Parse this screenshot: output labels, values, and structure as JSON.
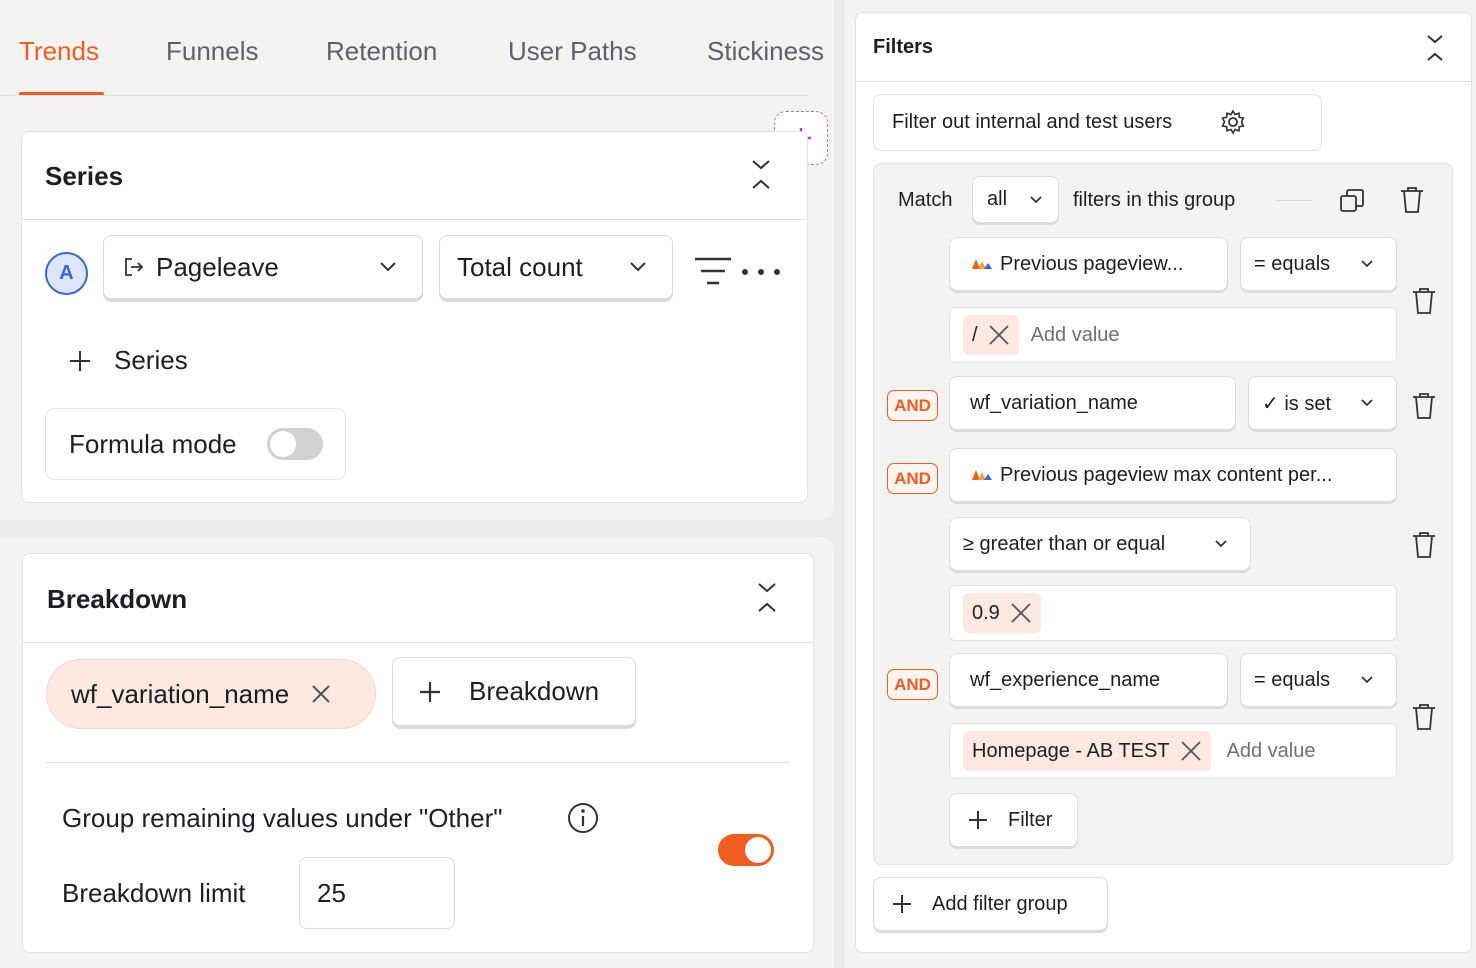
{
  "tabs": [
    {
      "label": "Trends",
      "active": true
    },
    {
      "label": "Funnels",
      "active": false
    },
    {
      "label": "Retention",
      "active": false
    },
    {
      "label": "User Paths",
      "active": false
    },
    {
      "label": "Stickiness",
      "active": false
    }
  ],
  "series": {
    "title": "Series",
    "letter": "A",
    "event_label": "Pageleave",
    "math_label": "Total count",
    "add_series_label": "Series",
    "formula_mode_label": "Formula mode",
    "formula_mode_on": false
  },
  "breakdown": {
    "title": "Breakdown",
    "tag_label": "wf_variation_name",
    "add_breakdown_label": "Breakdown",
    "group_other_label": "Group remaining values under \"Other\"",
    "group_other_on": true,
    "limit_label": "Breakdown limit",
    "limit_value": "25"
  },
  "filters": {
    "title": "Filters",
    "internal_label": "Filter out internal and test users",
    "internal_on": false,
    "match_label": "Match",
    "match_value": "all",
    "group_suffix": "filters in this group",
    "and_label": "AND",
    "add_value_placeholder": "Add value",
    "rows": [
      {
        "property": "Previous pageview...",
        "operator": "= equals",
        "values": [
          "/"
        ]
      },
      {
        "property": "wf_variation_name",
        "operator": "✓ is set",
        "values": []
      },
      {
        "property": "Previous pageview max content per...",
        "operator": "≥ greater than or equal",
        "values": [
          "0.9"
        ]
      },
      {
        "property": "wf_experience_name",
        "operator": "= equals",
        "values": [
          "Homepage - AB TEST"
        ]
      }
    ],
    "add_filter_label": "Filter",
    "add_group_label": "Add filter group"
  },
  "colors": {
    "accent": "#f25c1f",
    "series_badge": "#3c65e0",
    "plus_purple": "#a541e8"
  }
}
